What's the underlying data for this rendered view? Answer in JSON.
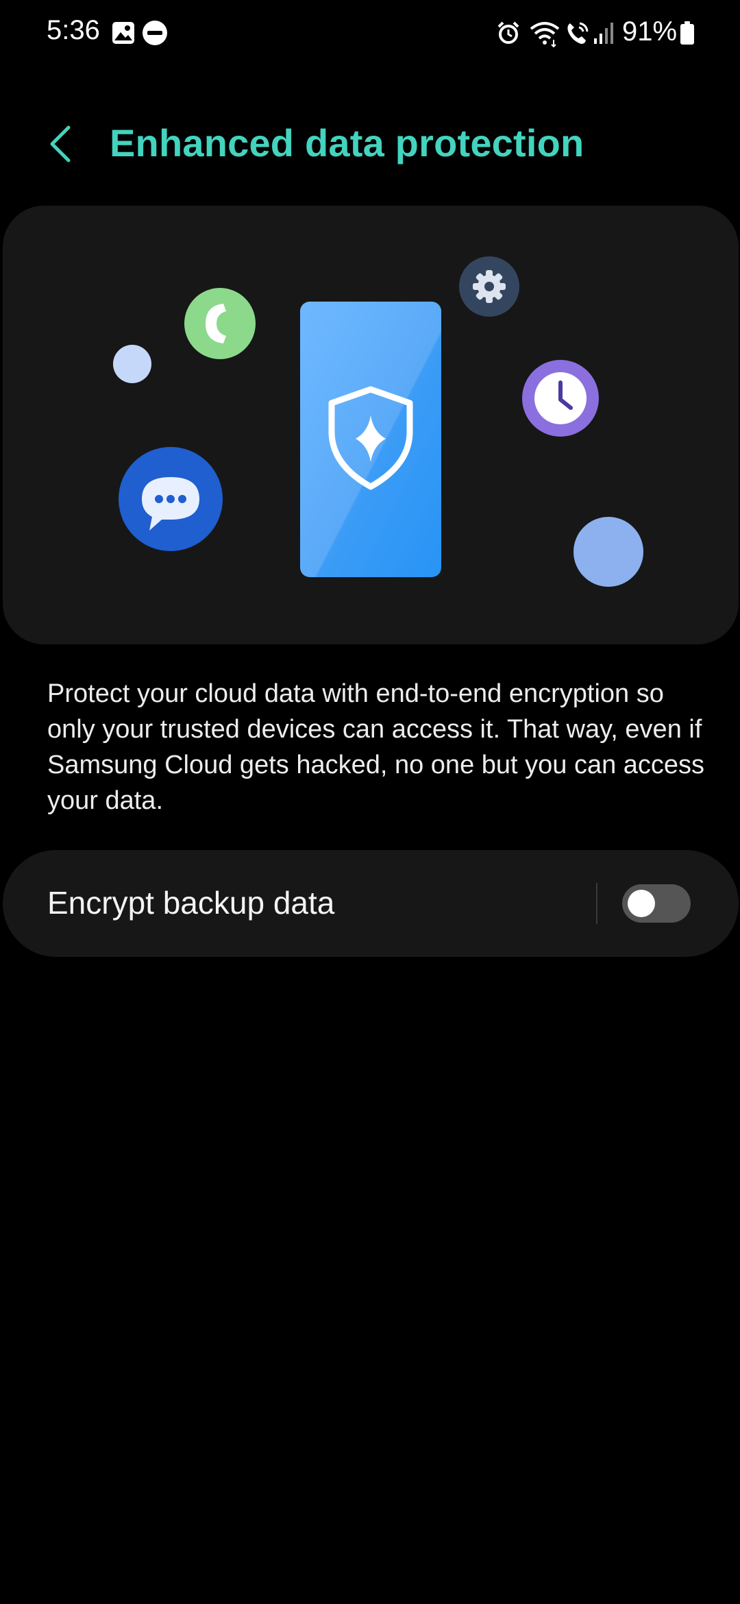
{
  "status_bar": {
    "time": "5:36",
    "battery_percent": "91%",
    "left_icons": [
      "gallery-notification-icon",
      "do-not-disturb-icon"
    ],
    "right_icons": [
      "alarm-icon",
      "wifi-icon",
      "wifi-calling-icon",
      "signal-icon",
      "battery-icon"
    ]
  },
  "header": {
    "back_icon": "chevron-left-icon",
    "title": "Enhanced data protection"
  },
  "illustration": {
    "icons": [
      "phone-shield-icon",
      "call-icon",
      "chat-icon",
      "settings-icon",
      "clock-icon"
    ]
  },
  "description": "Protect your cloud data with end-to-end encryption so only your trusted devices can access it. That way, even if Samsung Cloud gets hacked, no one but you can access your data.",
  "settings": {
    "encrypt_backup": {
      "label": "Encrypt backup data",
      "enabled": false
    }
  },
  "colors": {
    "accent": "#43D3BE",
    "background": "#000000",
    "card": "#171717",
    "toggle_off": "#555555"
  }
}
